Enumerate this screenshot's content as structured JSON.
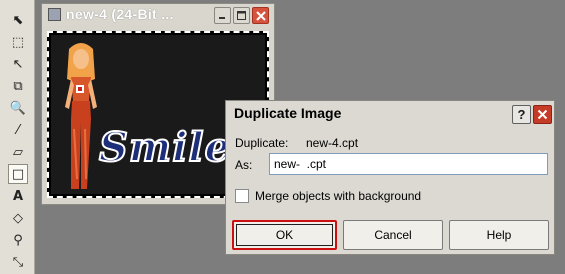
{
  "toolbar": {
    "tools": [
      {
        "name": "pick-tool-icon",
        "glyph": "⬉"
      },
      {
        "name": "rectangle-mask-icon",
        "glyph": "⬚"
      },
      {
        "name": "lasso-mask-icon",
        "glyph": "↖"
      },
      {
        "name": "crop-tool-icon",
        "glyph": "⧉"
      },
      {
        "name": "zoom-tool-icon",
        "glyph": "🔍"
      },
      {
        "name": "eyedropper-icon",
        "glyph": "⁄"
      },
      {
        "name": "eraser-icon",
        "glyph": "▱"
      },
      {
        "name": "red-eye-icon",
        "glyph": "∕"
      },
      {
        "name": "rectangle-tool-icon",
        "glyph": "□"
      },
      {
        "name": "text-tool-icon",
        "glyph": "A"
      },
      {
        "name": "fill-tool-icon",
        "glyph": "◇"
      },
      {
        "name": "paint-tool-icon",
        "glyph": "⚲"
      }
    ]
  },
  "image_window": {
    "title": "new-4   (24-Bit ..."
  },
  "canvas": {
    "text": "Smile"
  },
  "dialog": {
    "title": "Duplicate Image",
    "help_glyph": "?",
    "duplicate_label": "Duplicate:",
    "duplicate_value": "new-4.cpt",
    "as_label": "As:",
    "as_value": "new-  .cpt",
    "merge_label": "Merge objects with background",
    "merge_checked": false,
    "ok_label": "OK",
    "cancel_label": "Cancel",
    "help_label": "Help"
  },
  "colors": {
    "background": "#7d7d7d",
    "toolbar": "#e2dfd6",
    "dialog": "#dcd9d2",
    "close_button": "#c63a28",
    "ok_highlight": "#cc1010",
    "smile_text": "#1e2f7a"
  }
}
